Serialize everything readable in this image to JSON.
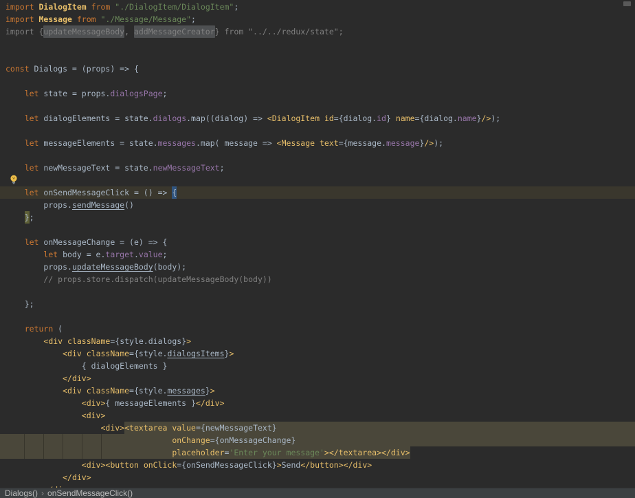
{
  "window": {
    "kind": "code-editor",
    "editor_bg": "#2b2b2b"
  },
  "colors": {
    "editor_bg": "#2b2b2b",
    "keyword": "#cc7832",
    "string": "#6a8759",
    "default_text": "#a9b7c6",
    "property": "#9876aa",
    "jsx_tag": "#e8bf6a",
    "comment_gray": "#808080",
    "selection_bg": "#4a473a",
    "caret_line_bg": "#3a372d",
    "identifier_box_bg": "#4e5052",
    "brace_match_open_bg": "#31557f",
    "brace_match_close_bg": "#5e6037",
    "breadcrumb_bg": "#3c4042",
    "breadcrumb_text": "#bbbbbb"
  },
  "icons": {
    "lightbulb": "intention-lightbulb",
    "breadcrumb_separator": "chevron-right"
  },
  "editor": {
    "lines": [
      {
        "t": [
          [
            "k",
            "import "
          ],
          [
            "imp",
            "DialogItem"
          ],
          [
            "k",
            " from "
          ],
          [
            "s",
            "\"./DialogItem/DialogItem\""
          ],
          [
            "d",
            ";"
          ]
        ]
      },
      {
        "t": [
          [
            "k",
            "import "
          ],
          [
            "imp",
            "Message"
          ],
          [
            "k",
            " from "
          ],
          [
            "s",
            "\"./Message/Message\""
          ],
          [
            "d",
            ";"
          ]
        ]
      },
      {
        "t": [
          [
            "g",
            "import {"
          ],
          [
            "g hl",
            "updateMessageBody"
          ],
          [
            "g",
            ", "
          ],
          [
            "g hl",
            "addMessageCreator"
          ],
          [
            "g",
            "} from "
          ],
          [
            "g",
            "\"../../redux/state\""
          ],
          [
            "g",
            ";"
          ]
        ]
      },
      {},
      {},
      {
        "t": [
          [
            "k",
            "const "
          ],
          [
            "d",
            "Dialogs = (props) => {"
          ]
        ]
      },
      {},
      {
        "t": [
          [
            "d",
            4
          ],
          [
            "k",
            "let "
          ],
          [
            "d",
            "state = props."
          ],
          [
            "p",
            "dialogsPage"
          ],
          [
            "d",
            ";"
          ]
        ]
      },
      {},
      {
        "t": [
          [
            "d",
            4
          ],
          [
            "k",
            "let "
          ],
          [
            "d",
            "dialogElements = state."
          ],
          [
            "p",
            "dialogs"
          ],
          [
            "d",
            ".map((dialog) => "
          ],
          [
            "t",
            "<DialogItem"
          ],
          [
            "d",
            " "
          ],
          [
            "t",
            "id"
          ],
          [
            "d",
            "={dialog."
          ],
          [
            "p",
            "id"
          ],
          [
            "d",
            "} "
          ],
          [
            "t",
            "name"
          ],
          [
            "d",
            "={dialog."
          ],
          [
            "p",
            "name"
          ],
          [
            "d",
            "}"
          ],
          [
            "t",
            "/>"
          ],
          [
            "d",
            ");"
          ]
        ]
      },
      {},
      {
        "t": [
          [
            "d",
            4
          ],
          [
            "k",
            "let "
          ],
          [
            "d",
            "messageElements = state."
          ],
          [
            "p",
            "messages"
          ],
          [
            "d",
            ".map( message => "
          ],
          [
            "t",
            "<Message"
          ],
          [
            "d",
            " "
          ],
          [
            "t",
            "text"
          ],
          [
            "d",
            "={message."
          ],
          [
            "p",
            "message"
          ],
          [
            "d",
            "}"
          ],
          [
            "t",
            "/>"
          ],
          [
            "d",
            ");"
          ]
        ]
      },
      {},
      {
        "t": [
          [
            "d",
            4
          ],
          [
            "k",
            "let "
          ],
          [
            "d",
            "newMessageText = state."
          ],
          [
            "p",
            "newMessageText"
          ],
          [
            "d",
            ";"
          ]
        ]
      },
      {},
      {
        "cls": "caret",
        "t": [
          [
            "d",
            4
          ],
          [
            "k",
            "let "
          ],
          [
            "d",
            "onSendMessageClick = () => "
          ],
          [
            "d bl",
            "{"
          ]
        ]
      },
      {
        "t": [
          [
            "d",
            8
          ],
          [
            "d",
            "props."
          ],
          [
            "d u",
            "sendMessage"
          ],
          [
            "d",
            "()"
          ]
        ]
      },
      {
        "t": [
          [
            "d",
            4
          ],
          [
            "d br",
            "}"
          ],
          [
            "d",
            ";"
          ]
        ]
      },
      {},
      {
        "t": [
          [
            "d",
            4
          ],
          [
            "k",
            "let "
          ],
          [
            "d",
            "onMessageChange = (e) => {"
          ]
        ]
      },
      {
        "t": [
          [
            "d",
            8
          ],
          [
            "k",
            "let "
          ],
          [
            "d",
            "body = e."
          ],
          [
            "p",
            "target"
          ],
          [
            "d",
            "."
          ],
          [
            "p",
            "value"
          ],
          [
            "d",
            ";"
          ]
        ]
      },
      {
        "t": [
          [
            "d",
            8
          ],
          [
            "d",
            "props."
          ],
          [
            "d u",
            "updateMessageBody"
          ],
          [
            "d",
            "(body);"
          ]
        ]
      },
      {
        "t": [
          [
            "g",
            8
          ],
          [
            "g",
            "// props.store.dispatch(updateMessageBody(body))"
          ]
        ]
      },
      {},
      {
        "t": [
          [
            "d",
            4
          ],
          [
            "d",
            "};"
          ]
        ]
      },
      {},
      {
        "t": [
          [
            "d",
            4
          ],
          [
            "k",
            "return"
          ],
          [
            "d",
            " ("
          ]
        ]
      },
      {
        "t": [
          [
            "d",
            8
          ],
          [
            "t",
            "<div"
          ],
          [
            "d",
            " "
          ],
          [
            "t",
            "className"
          ],
          [
            "d",
            "={style.dialogs}"
          ],
          [
            "t",
            ">"
          ]
        ]
      },
      {
        "t": [
          [
            "d",
            12
          ],
          [
            "t",
            "<div"
          ],
          [
            "d",
            " "
          ],
          [
            "t",
            "className"
          ],
          [
            "d",
            "={style."
          ],
          [
            "d u",
            "dialogsItems"
          ],
          [
            "d",
            "}"
          ],
          [
            "t",
            ">"
          ]
        ]
      },
      {
        "t": [
          [
            "d",
            16
          ],
          [
            "d",
            "{ dialogElements }"
          ]
        ]
      },
      {
        "t": [
          [
            "d",
            12
          ],
          [
            "t",
            "</div>"
          ]
        ]
      },
      {
        "t": [
          [
            "d",
            12
          ],
          [
            "t",
            "<div"
          ],
          [
            "d",
            " "
          ],
          [
            "t",
            "className"
          ],
          [
            "d",
            "={style."
          ],
          [
            "d u",
            "messages"
          ],
          [
            "d",
            "}"
          ],
          [
            "t",
            ">"
          ]
        ]
      },
      {
        "t": [
          [
            "d",
            16
          ],
          [
            "t",
            "<div>"
          ],
          [
            "d",
            "{ messageElements }"
          ],
          [
            "t",
            "</div>"
          ]
        ]
      },
      {
        "t": [
          [
            "d",
            16
          ],
          [
            "t",
            "<div>"
          ]
        ]
      },
      {
        "fill": true,
        "t": [
          [
            "d",
            20
          ],
          [
            "t",
            "<div>"
          ],
          [
            "t sel",
            "<textarea"
          ],
          [
            "d sel",
            " "
          ],
          [
            "t sel",
            "value"
          ],
          [
            "d sel",
            "={newMessageText}"
          ]
        ]
      },
      {
        "cls": "selrow",
        "t": [
          [
            "d sel",
            35
          ],
          [
            "t sel",
            "onChange"
          ],
          [
            "d sel",
            "={onMessageChange}"
          ]
        ]
      },
      {
        "cls": "padsel",
        "t": [
          [
            "d sel",
            35
          ],
          [
            "t sel",
            "placeholder"
          ],
          [
            "d sel",
            "="
          ],
          [
            "s sel",
            "'Enter your message'"
          ],
          [
            "t sel",
            "></textarea></div>"
          ]
        ]
      },
      {
        "t": [
          [
            "d",
            16
          ],
          [
            "t",
            "<div><button"
          ],
          [
            "d",
            " "
          ],
          [
            "t",
            "onClick"
          ],
          [
            "d",
            "={onSendMessageClick}"
          ],
          [
            "t",
            ">"
          ],
          [
            "d",
            "Send"
          ],
          [
            "t",
            "</button></div>"
          ]
        ]
      },
      {
        "t": [
          [
            "d",
            12
          ],
          [
            "t",
            "</div>"
          ]
        ]
      },
      {
        "t": [
          [
            "d",
            8
          ],
          [
            "t",
            "</div>"
          ]
        ]
      }
    ]
  },
  "breadcrumbs": {
    "items": [
      "Dialogs()",
      "onSendMessageClick()"
    ],
    "separator": "›"
  }
}
